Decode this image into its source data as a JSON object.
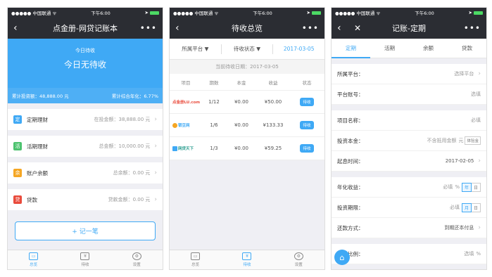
{
  "status": {
    "carrier": "●●●●● 中国联通 ᯤ",
    "time": "下午6:00"
  },
  "screen1": {
    "title": "点金册-网贷记账本",
    "more": "•••",
    "hero": {
      "label": "今日待收",
      "value": "今日无待收",
      "total_label": "累计投资额：48,888.00 元",
      "rate_label": "累计综合年化：6.77%"
    },
    "cards": [
      {
        "badge": "定",
        "color": "#3fa9f5",
        "label": "定期理财",
        "value": "在投金额：38,888.00 元"
      },
      {
        "badge": "活",
        "color": "#4cc26e",
        "label": "活期理财",
        "value": "总金额：10,000.00 元"
      },
      {
        "badge": "余",
        "color": "#f5a623",
        "label": "账户余额",
        "value": "总余额：0.00 元"
      },
      {
        "badge": "贷",
        "color": "#e94b3c",
        "label": "贷款",
        "value": "贷款金额：0.00 元"
      }
    ],
    "add_button": "+ 记一笔"
  },
  "tabbar": {
    "tabs": [
      "总览",
      "待收",
      "设置"
    ]
  },
  "screen2": {
    "title": "待收总览",
    "more": "•••",
    "filter": {
      "platform": "所属平台 ▼",
      "status": "待收状态 ▼",
      "date": "2017-03-05"
    },
    "current_date": "当前待收日期：2017-03-05",
    "headers": [
      "项目",
      "期数",
      "本金",
      "收益",
      "状态"
    ],
    "rows": [
      {
        "logo": "点金册LU.com",
        "logo_color": "#e94b3c",
        "period": "1/12",
        "principal": "¥0.00",
        "income": "¥50.00",
        "status": "待收"
      },
      {
        "logo": "银豆网",
        "logo_color": "#3fa9f5",
        "period": "1/6",
        "principal": "¥0.00",
        "income": "¥133.33",
        "status": "待收"
      },
      {
        "logo": "网贷天下",
        "logo_color": "#2a9d8f",
        "period": "1/3",
        "principal": "¥0.00",
        "income": "¥59.25",
        "status": "待收"
      }
    ]
  },
  "screen3": {
    "title": "记账-定期",
    "more": "•••",
    "tabs": [
      "定期",
      "活期",
      "余额",
      "贷款"
    ],
    "fields": {
      "platform": {
        "label": "所属平台：",
        "value": "选择平台"
      },
      "account": {
        "label": "平台账号：",
        "value": "选填"
      },
      "project": {
        "label": "项目名称：",
        "value": "必填"
      },
      "principal": {
        "label": "投资本金：",
        "value": "不含抵用金额",
        "unit": "元",
        "btn": "体验金"
      },
      "start": {
        "label": "起息时间：",
        "value": "2017-02-05"
      },
      "rate": {
        "label": "年化收益：",
        "value": "必填",
        "unit": "%",
        "seg": [
          "年",
          "日"
        ]
      },
      "term": {
        "label": "投资期限：",
        "value": "必填",
        "seg": [
          "月",
          "日"
        ]
      },
      "repay": {
        "label": "还款方式：",
        "value": "到期还本付息"
      },
      "ratio": {
        "label": "抵息比例：",
        "value": "选填",
        "unit": "%"
      }
    }
  }
}
